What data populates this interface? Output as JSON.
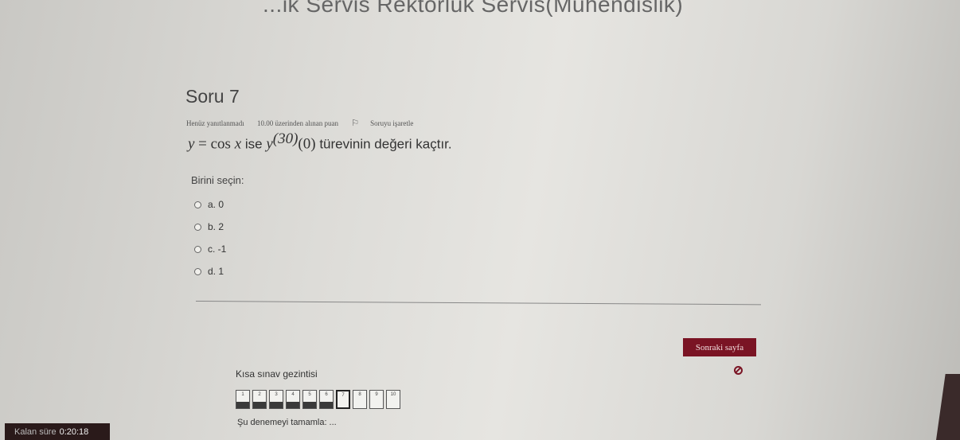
{
  "header": {
    "title": "...ik Servis Rektörlük Servis(Mühendislik)"
  },
  "question": {
    "number": "Soru 7",
    "status": "Henüz yanıtlanmadı",
    "points": "10.00 üzerinden alınan puan",
    "flag_label": "Soruyu işaretle",
    "text_var": "y",
    "text_eq": "=",
    "text_fn": "cos",
    "text_x": "x",
    "text_ise": "ise",
    "text_y2": "y",
    "text_order": "(30)",
    "text_arg": "(0)",
    "text_rest": "türevinin değeri kaçtır."
  },
  "prompt": "Birini seçin:",
  "answers": [
    {
      "label": "a. 0"
    },
    {
      "label": "b. 2"
    },
    {
      "label": "c. -1"
    },
    {
      "label": "d. 1"
    }
  ],
  "next_button": "Sonraki sayfa",
  "navigation": {
    "title": "Kısa sınav gezintisi",
    "buttons": [
      "1",
      "2",
      "3",
      "4",
      "5",
      "6",
      "7",
      "8",
      "9",
      "10"
    ],
    "answered": [
      1,
      2,
      3,
      4,
      5,
      6
    ],
    "current": 7
  },
  "finish_link": "Şu denemeyi tamamla: ...",
  "timer": {
    "label": "Kalan süre",
    "value": "0:20:18"
  },
  "colors": {
    "accent": "#7a1424"
  }
}
